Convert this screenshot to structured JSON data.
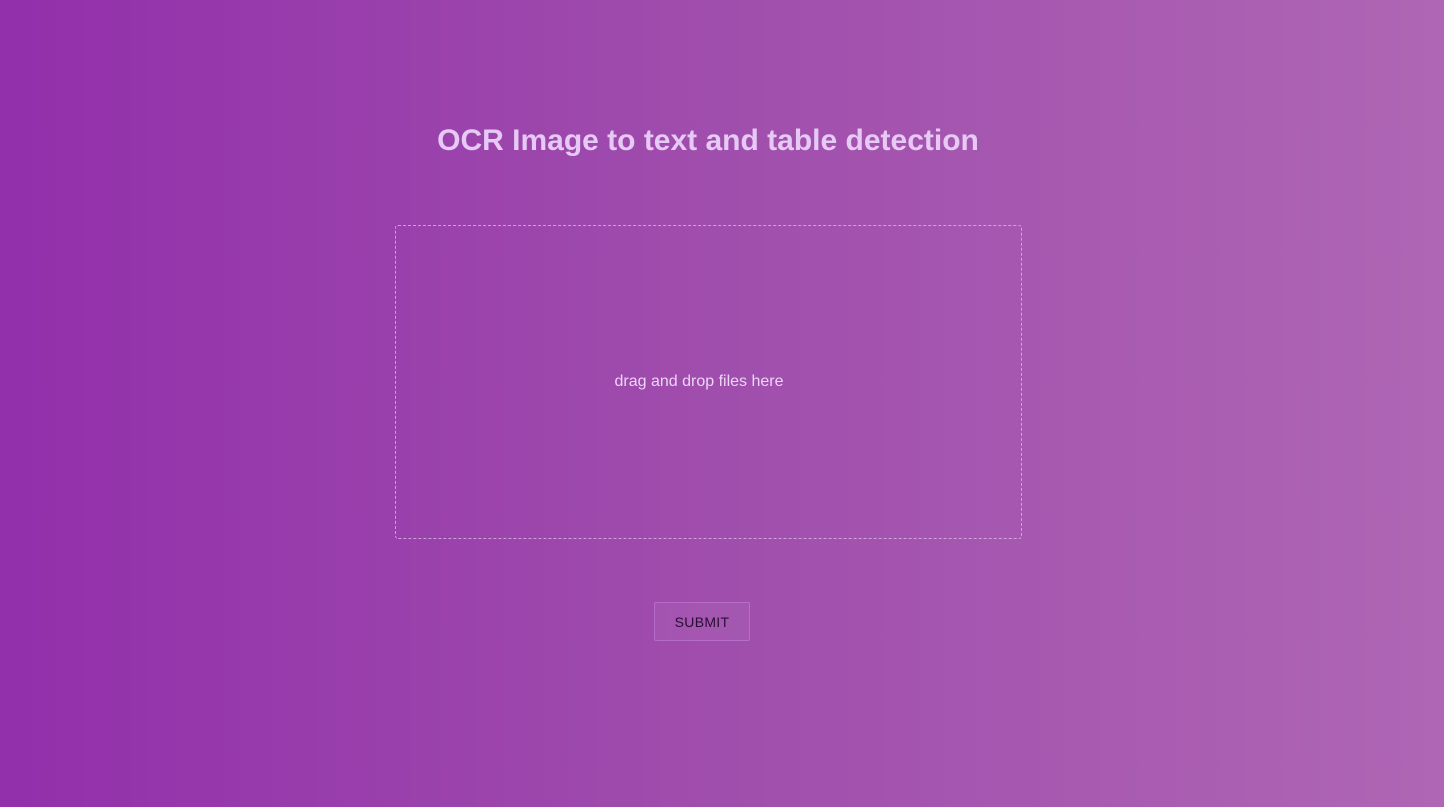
{
  "header": {
    "title": "OCR Image to text and table detection"
  },
  "upload": {
    "dropzone_text": "drag and drop files here"
  },
  "actions": {
    "submit_label": "SUBMIT"
  },
  "colors": {
    "background_start": "#922fab",
    "background_end": "#af66b4",
    "title_text": "#e6c9f4"
  }
}
